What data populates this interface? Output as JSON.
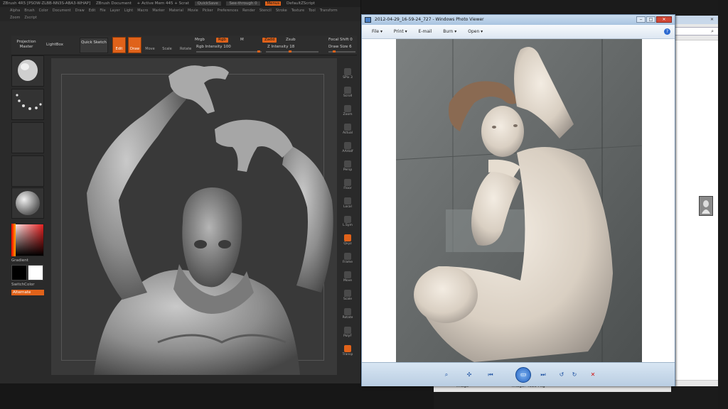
{
  "zbrush": {
    "title_items": [
      "ZBrush 4R5 [PSOW-ZLBB-NN3S-ABA3-WHAP]",
      "ZBrush Document",
      "+ Active Mem 445 + Scrat",
      "QuickSave",
      "See-through  0",
      "Menus",
      "DefaultZScript"
    ],
    "menu_row1": [
      "Alpha",
      "Brush",
      "Color",
      "Document",
      "Draw",
      "Edit",
      "File",
      "Layer",
      "Light",
      "Macro",
      "Marker",
      "Material",
      "Movie",
      "Picker",
      "Preferences",
      "Render",
      "Stencil",
      "Stroke",
      "Texture",
      "Tool",
      "Transform"
    ],
    "menu_row2": [
      "Zoom",
      "Zscript"
    ],
    "toolbar": {
      "projection_master": "Projection Master",
      "lightbox": "LightBox",
      "quick_sketch": "Quick Sketch",
      "edit": "Edit",
      "draw": "Draw",
      "move": "Move",
      "scale": "Scale",
      "rotate": "Rotate",
      "mrgb": "Mrgb",
      "rgb": "Rgb",
      "m": "M",
      "rgb_intensity": "Rgb Intensity 100",
      "zadd": "Zadd",
      "zsub": "Zsub",
      "z_intensity": "Z Intensity 18",
      "focal_shift": "Focal Shift 0",
      "draw_size": "Draw Size 6"
    },
    "left_panel": {
      "gradient": "Gradient",
      "switchcolor": "SwitchColor",
      "alternate": "Alternate"
    },
    "right_panel": [
      "SPix 3",
      "Scroll",
      "Zoom",
      "Actual",
      "AAHalf",
      "Persp",
      "Floor",
      "Local",
      "L.Sym",
      "Qxyz",
      "Frame",
      "Move",
      "Scale",
      "Rotate",
      "PolyF",
      "Transp"
    ]
  },
  "photo_viewer": {
    "title": "2012-04-29_16-59-24_727 - Windows Photo Viewer",
    "menu": [
      "File ▾",
      "Print ▾",
      "E-mail",
      "Burn ▾",
      "Open ▾"
    ],
    "help": "?",
    "nav_buttons": [
      "zoom",
      "actual-size",
      "previous",
      "slideshow",
      "next",
      "rotate-ccw",
      "rotate-cw",
      "delete"
    ]
  },
  "background_window": {
    "bottom_text": [
      "Image",
      "Image: 4080 Pkg"
    ]
  }
}
